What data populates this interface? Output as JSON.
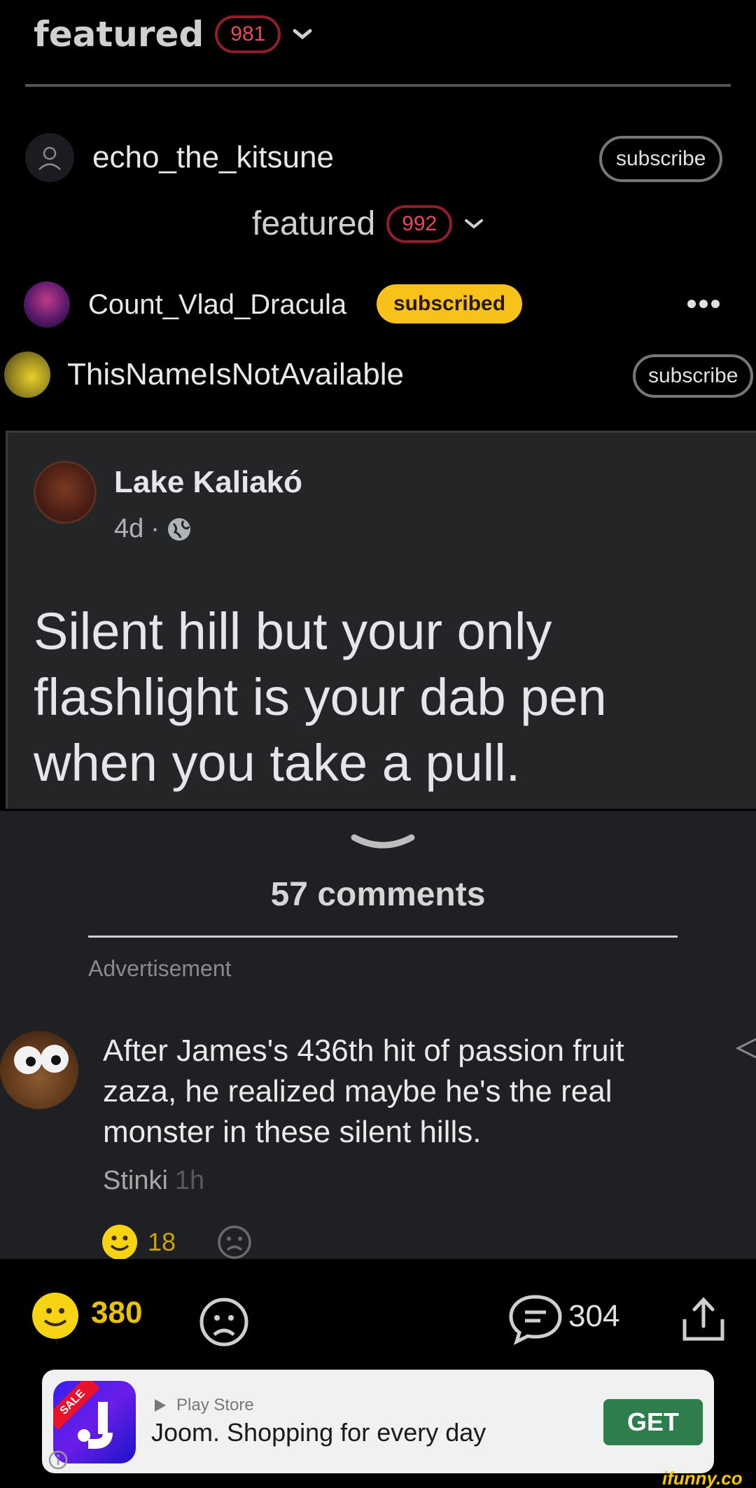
{
  "top_bar": {
    "label": "featured",
    "count": "981"
  },
  "users": [
    {
      "name": "echo_the_kitsune",
      "button": "subscribe"
    },
    {
      "name": "Count_Vlad_Dracula",
      "button": "subscribed"
    },
    {
      "name": "ThisNameIsNotAvailable",
      "button": "subscribe"
    }
  ],
  "mid_featured": {
    "label": "featured",
    "count": "992"
  },
  "fb_post": {
    "author": "Lake Kaliakó",
    "time": "4d",
    "separator": "·",
    "text": "Silent hill but your only flashlight is your dab pen when you take a pull."
  },
  "comments_header": {
    "count_label": "57 comments",
    "ad_label": "Advertisement"
  },
  "comment": {
    "text": "After James's 436th hit of passion fruit zaza, he realized maybe he's the real monster in these silent hills.",
    "author": "Stinki",
    "time": "1h",
    "smiles": "18"
  },
  "action_bar": {
    "smiles": "380",
    "comments": "304"
  },
  "ad": {
    "badge": "SALE",
    "store": "Play Store",
    "title": "Joom. Shopping for every day",
    "cta": "GET"
  },
  "watermark": "ifunny.co",
  "colors": {
    "accent_yellow": "#f8c21a",
    "badge_red": "#e84a5a",
    "ad_green": "#2e7d4d"
  }
}
